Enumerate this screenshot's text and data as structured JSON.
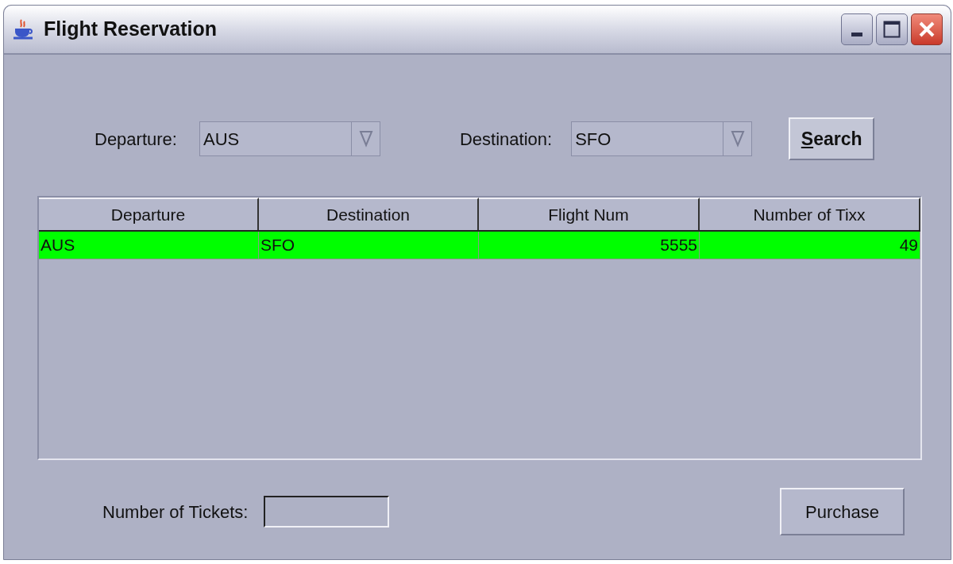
{
  "window": {
    "title": "Flight Reservation"
  },
  "search_form": {
    "departure": {
      "label": "Departure:",
      "value": "AUS"
    },
    "destination": {
      "label": "Destination:",
      "value": "SFO"
    },
    "search_button": "Search"
  },
  "table": {
    "columns": [
      "Departure",
      "Destination",
      "Flight Num",
      "Number of Tixx"
    ],
    "rows": [
      {
        "cells": [
          "AUS",
          "SFO",
          "5555",
          "49"
        ],
        "selected": true
      }
    ]
  },
  "tickets": {
    "label": "Number of Tickets:"
  },
  "purchase_button": "Purchase"
}
